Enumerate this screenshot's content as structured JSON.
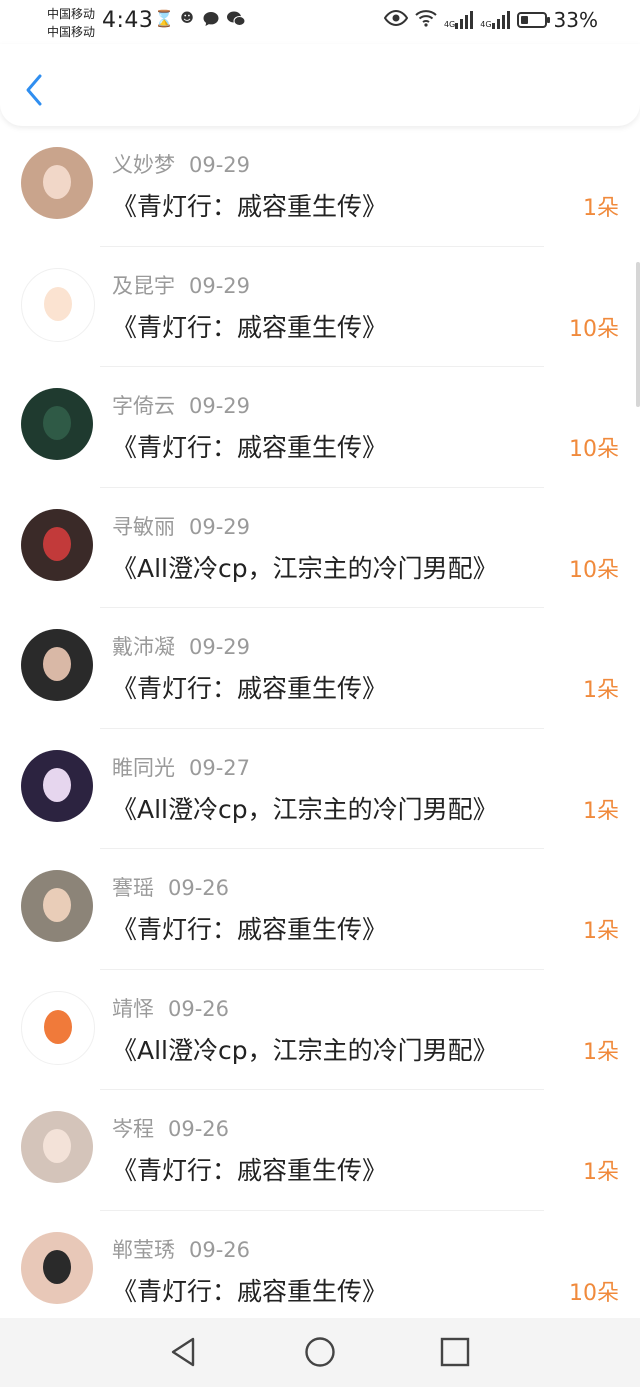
{
  "status_bar": {
    "carrier_1": "中国移动",
    "carrier_2": "中国移动",
    "time": "4:43",
    "icons_left": [
      "hourglass-icon",
      "notification-icon",
      "chat-bubble-icon",
      "wechat-icon"
    ],
    "icons_right": [
      "eye-icon",
      "wifi-icon",
      "signal-4g-icon",
      "signal-4g-icon",
      "battery-icon"
    ],
    "network_label_1": "4G",
    "network_label_2": "4G",
    "battery_percent": "33%",
    "battery_level": 0.33
  },
  "header": {
    "back_icon": "chevron-left-icon",
    "accent_color": "#2f8ef0"
  },
  "colors": {
    "gift_count": "#f08a3c",
    "name": "#9a9a9a",
    "title": "#222222"
  },
  "gift_list": [
    {
      "name": "义妙梦",
      "date": "09-29",
      "title": "《青灯行：戚容重生传》",
      "count": "1朵",
      "avatar_bg": "#c9a48c",
      "avatar_face": "#f1d7c8"
    },
    {
      "name": "及昆宇",
      "date": "09-29",
      "title": "《青灯行：戚容重生传》",
      "count": "10朵",
      "avatar_bg": "#ffffff",
      "avatar_face": "#fbe3d1"
    },
    {
      "name": "字倚云",
      "date": "09-29",
      "title": "《青灯行：戚容重生传》",
      "count": "10朵",
      "avatar_bg": "#1f3a2f",
      "avatar_face": "#2f5a46"
    },
    {
      "name": "寻敏丽",
      "date": "09-29",
      "title": "《All澄冷cp，江宗主的冷门男配》",
      "count": "10朵",
      "avatar_bg": "#3a2a28",
      "avatar_face": "#c23a3a"
    },
    {
      "name": "戴沛凝",
      "date": "09-29",
      "title": "《青灯行：戚容重生传》",
      "count": "1朵",
      "avatar_bg": "#2a2a2a",
      "avatar_face": "#d9b8a6"
    },
    {
      "name": "睢同光",
      "date": "09-27",
      "title": "《All澄冷cp，江宗主的冷门男配》",
      "count": "1朵",
      "avatar_bg": "#2c2340",
      "avatar_face": "#e6d6ee"
    },
    {
      "name": "謇瑶",
      "date": "09-26",
      "title": "《青灯行：戚容重生传》",
      "count": "1朵",
      "avatar_bg": "#8c8478",
      "avatar_face": "#e9cdb8"
    },
    {
      "name": "靖怿",
      "date": "09-26",
      "title": "《All澄冷cp，江宗主的冷门男配》",
      "count": "1朵",
      "avatar_bg": "#ffffff",
      "avatar_face": "#f07a3a"
    },
    {
      "name": "岑程",
      "date": "09-26",
      "title": "《青灯行：戚容重生传》",
      "count": "1朵",
      "avatar_bg": "#d4c4ba",
      "avatar_face": "#f3e2d8"
    },
    {
      "name": "郸莹琇",
      "date": "09-26",
      "title": "《青灯行：戚容重生传》",
      "count": "10朵",
      "avatar_bg": "#e8c8b8",
      "avatar_face": "#2a2a2a"
    }
  ],
  "nav_bar": {
    "buttons": [
      "back-triangle-icon",
      "home-circle-icon",
      "recents-square-icon"
    ]
  }
}
